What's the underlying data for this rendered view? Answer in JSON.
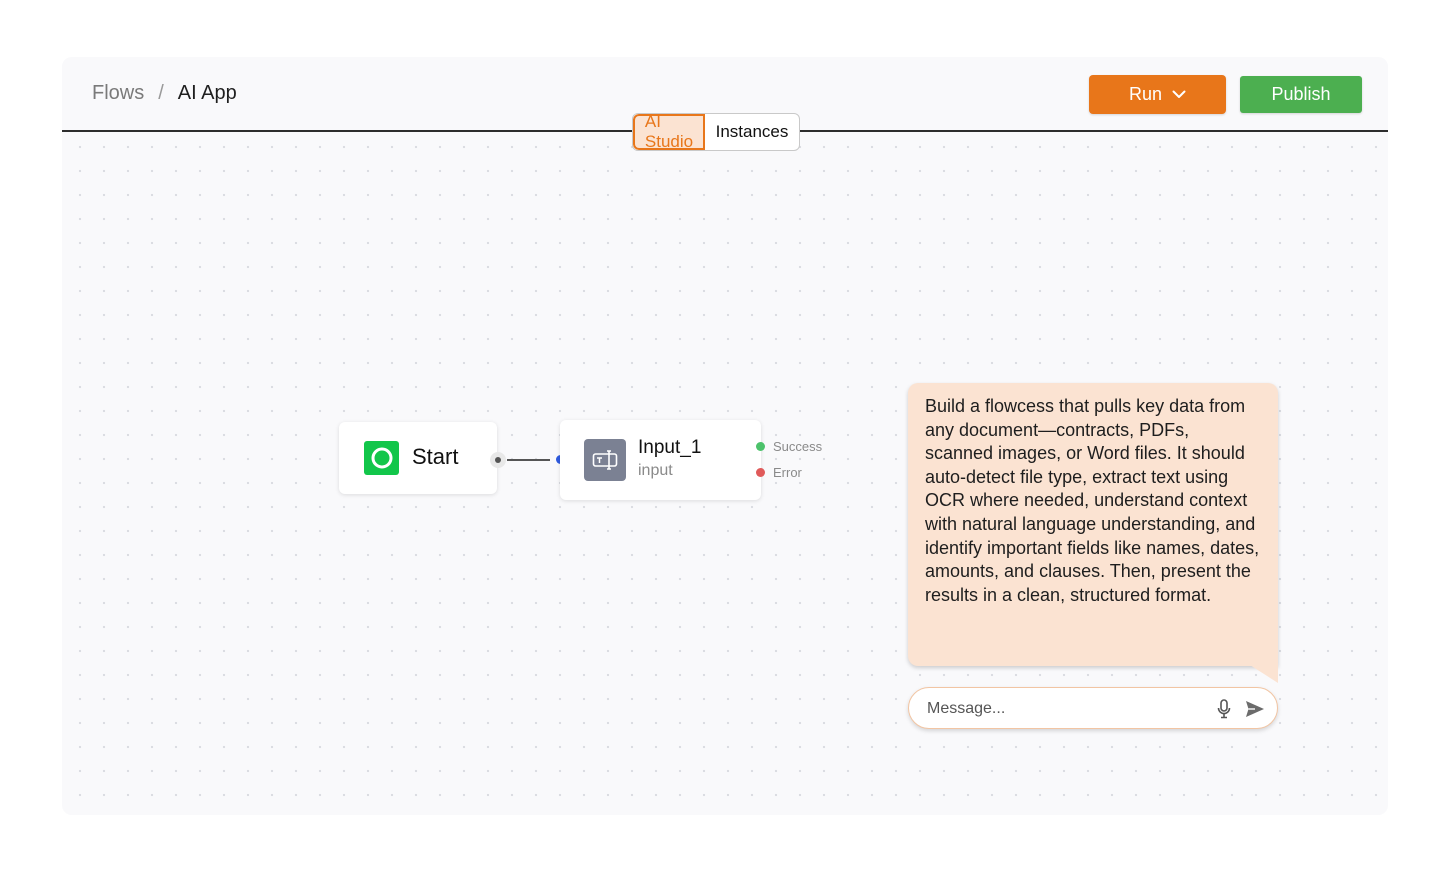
{
  "breadcrumb": {
    "root": "Flows",
    "separator": "/",
    "current": "AI App"
  },
  "toolbar": {
    "run_label": "Run",
    "publish_label": "Publish",
    "run_color": "#e8761a",
    "publish_color": "#4caf50"
  },
  "tabs": [
    {
      "label": "AI Studio",
      "active": true
    },
    {
      "label": "Instances",
      "active": false
    }
  ],
  "canvas": {
    "nodes": {
      "start": {
        "label": "Start",
        "icon": "circle-icon",
        "icon_color": "#12c64a"
      },
      "input": {
        "title": "Input_1",
        "subtitle": "input",
        "icon": "text-input-icon",
        "outputs": [
          {
            "label": "Success",
            "color": "#4cc26b"
          },
          {
            "label": "Error",
            "color": "#e05a5a"
          }
        ]
      }
    }
  },
  "chat": {
    "message": "Build a flowcess that pulls key data from any document—contracts, PDFs, scanned images, or Word files. It should auto-detect file type, extract text using OCR where needed, understand context with natural language understanding, and identify important fields like names, dates, amounts, and clauses. Then, present the results in a clean, structured format.",
    "input_placeholder": "Message...",
    "bubble_color": "#fbe3d2"
  }
}
